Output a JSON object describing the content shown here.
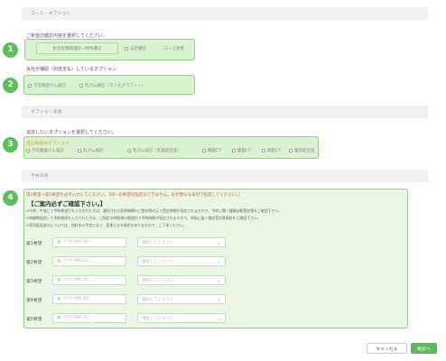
{
  "sections": {
    "course": "コース・オプション",
    "options": "オプション追加",
    "schedule": "予約日時"
  },
  "course": {
    "note": "ご希望の健診内容を選択してください。",
    "selected_pill": "生活習慣病健診+特殊健診",
    "other_checkbox": "法定健診",
    "change_link": "コース変更"
  },
  "subsidized": {
    "note": "会社が補助（別途支払）しているオプション",
    "items": [
      "子宮頸部がん検診",
      "乳がん検診（マンモグラフィー）"
    ]
  },
  "options": {
    "note": "追加したいオプションを選択してください。",
    "self_pay_label": "自己負担のオプション",
    "items": [
      "子宮頸部がん検診",
      "乳がん検診",
      "乳がん検診（乳腺超音波）",
      "胸部CT",
      "腹部CT",
      "頭部CT",
      "腹部超音波"
    ]
  },
  "schedule": {
    "warning": "第1希望〜第5希望を必ず入力してください。（同一の希望日指定はできません。必ず異なる日付で指定してください。）",
    "notice_title": "【ご案内必ずご確認下さい。】",
    "notice_lines": [
      "※午前、午後にて予約希望日を入力された方は、選択された医療機関のご都合等の元で受診時間が指定されますので、予約に関く健康診断受診票をご確認下さい。",
      "※時間帯指定して予約希望を入力された方は、ご指定の時間帯の範囲内で予約時間が指定されますので、余裕に届く健診受診票資料をご確認下さい。",
      "※費用延長部分については、別料金の予定となり、変更となる場合がありますので、ご了承ください。"
    ],
    "date_placeholder": "YYYY-MM-DD",
    "time_placeholder": "選択してください",
    "rows": [
      "第1希望",
      "第2希望",
      "第3希望",
      "第4希望",
      "第5希望"
    ]
  },
  "footer": {
    "cancel": "キャンセル",
    "confirm": "確認へ"
  },
  "markers": [
    "1",
    "2",
    "3",
    "4"
  ],
  "colors": {
    "accent_green": "#5cb85c",
    "highlight_fill": "#d9f2d0",
    "highlight_border": "#8fd27f",
    "warning_red": "#e0533f",
    "label_orange": "#e0962c"
  }
}
